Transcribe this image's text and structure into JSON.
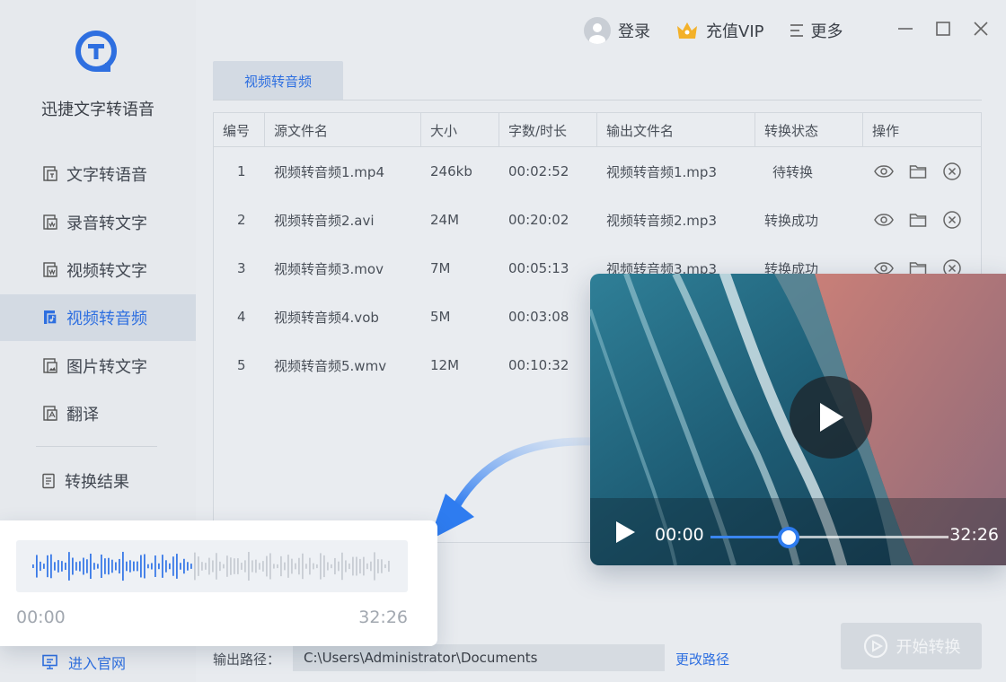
{
  "app": {
    "brand": "迅捷文字转语音"
  },
  "sidebar": {
    "items": [
      {
        "label": "文字转语音",
        "icon": "text-doc-icon"
      },
      {
        "label": "录音转文字",
        "icon": "audio-doc-icon"
      },
      {
        "label": "视频转文字",
        "icon": "video-doc-icon"
      },
      {
        "label": "视频转音频",
        "icon": "video-audio-icon"
      },
      {
        "label": "图片转文字",
        "icon": "image-doc-icon"
      },
      {
        "label": "翻译",
        "icon": "translate-icon"
      }
    ],
    "results": "转换结果",
    "website": "进入官网"
  },
  "topbar": {
    "login": "登录",
    "vip": "充值VIP",
    "more": "更多"
  },
  "tab": {
    "label": "视频转音频"
  },
  "table": {
    "headers": [
      "编号",
      "源文件名",
      "大小",
      "字数/时长",
      "输出文件名",
      "转换状态",
      "操作"
    ],
    "rows": [
      {
        "no": "1",
        "src": "视频转音频1.mp4",
        "size": "246kb",
        "dur": "00:02:52",
        "out": "视频转音频1.mp3",
        "status": "待转换"
      },
      {
        "no": "2",
        "src": "视频转音频2.avi",
        "size": "24M",
        "dur": "00:20:02",
        "out": "视频转音频2.mp3",
        "status": "转换成功"
      },
      {
        "no": "3",
        "src": "视频转音频3.mov",
        "size": "7M",
        "dur": "00:05:13",
        "out": "视频转音频3.mp3",
        "status": "转换成功"
      },
      {
        "no": "4",
        "src": "视频转音频4.vob",
        "size": "5M",
        "dur": "00:03:08",
        "out": "",
        "status": ""
      },
      {
        "no": "5",
        "src": "视频转音频5.wmv",
        "size": "12M",
        "dur": "00:10:32",
        "out": "",
        "status": ""
      }
    ]
  },
  "bottom": {
    "output_label": "输出路径：",
    "output_path": "C:\\Users\\Administrator\\Documents",
    "change_path": "更改路径",
    "start": "开始转换"
  },
  "video": {
    "time_current": "00:00",
    "time_total": "32:26",
    "progress": 0.33
  },
  "audio": {
    "time_current": "00:00",
    "time_total": "32:26",
    "played": 0.45
  },
  "colors": {
    "accent": "#2e6fe0",
    "sidebar_bg": "#e6e9ed",
    "active_bg": "#d3dae3"
  }
}
